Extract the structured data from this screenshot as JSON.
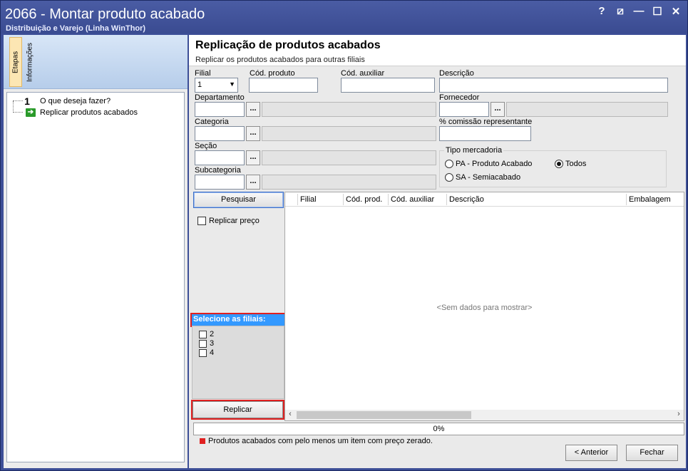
{
  "window": {
    "title": "2066 - Montar produto acabado",
    "subtitle": "Distribuição e Varejo (Linha WinThor)",
    "controls": {
      "help": "?",
      "restore": "⧄",
      "minimize": "—",
      "maximize": "☐",
      "close": "✕"
    }
  },
  "left": {
    "tabs": [
      "Etapas",
      "Informações"
    ],
    "steps": [
      {
        "num": "1",
        "label": "O que deseja fazer?"
      },
      {
        "num": "",
        "label": "Replicar produtos acabados"
      }
    ]
  },
  "header": {
    "title": "Replicação de produtos acabados",
    "subtitle": "Replicar os produtos acabados para outras filiais"
  },
  "form": {
    "filial_label": "Filial",
    "filial_value": "1",
    "cod_produto_label": "Cód. produto",
    "cod_auxiliar_label": "Cód. auxiliar",
    "descricao_label": "Descrição",
    "departamento_label": "Departamento",
    "fornecedor_label": "Fornecedor",
    "categoria_label": "Categoria",
    "comissao_label": "% comissão representante",
    "secao_label": "Seção",
    "subcategoria_label": "Subcategoria",
    "dots": "...",
    "tipo_mercadoria": {
      "legend": "Tipo mercadoria",
      "options": [
        "PA - Produto Acabado",
        "Todos",
        "SA - Semiacabado"
      ],
      "selected": "Todos"
    }
  },
  "actions": {
    "pesquisar": "Pesquisar",
    "replicar_preco": "Replicar preço",
    "filiais_header": "Selecione as filiais:",
    "filiais": [
      "2",
      "3",
      "4"
    ],
    "replicar": "Replicar"
  },
  "grid": {
    "columns": [
      "Filial",
      "Cód. prod.",
      "Cód. auxiliar",
      "Descrição",
      "Embalagem"
    ],
    "empty_text": "<Sem dados para mostrar>"
  },
  "progress": {
    "text": "0%",
    "value": 0
  },
  "legend": {
    "text": "Produtos acabados com pelo menos um item com preço zerado.",
    "color": "#e02020"
  },
  "footer": {
    "anterior": "< Anterior",
    "fechar": "Fechar"
  }
}
